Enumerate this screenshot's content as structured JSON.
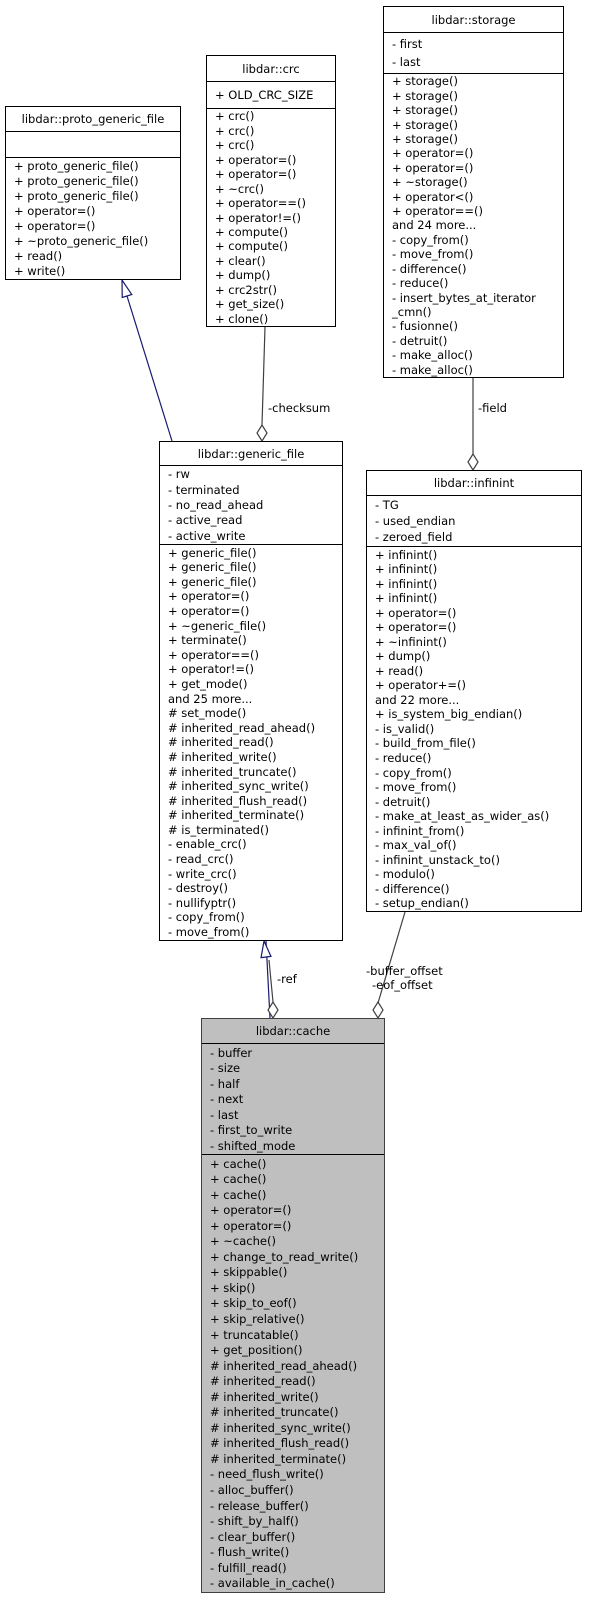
{
  "diagram": {
    "focus_class": "libdar::cache",
    "colors": {
      "inheritance": "#191970",
      "aggregation": "#404040",
      "focus_fill": "#bfbfbf"
    },
    "classes": [
      {
        "id": "proto",
        "name": "libdar::proto_generic_file",
        "attributes": [],
        "methods": [
          "+ proto_generic_file()",
          "+ proto_generic_file()",
          "+ proto_generic_file()",
          "+ operator=()",
          "+ operator=()",
          "+ ~proto_generic_file()",
          "+ read()",
          "+ write()"
        ]
      },
      {
        "id": "crc",
        "name": "libdar::crc",
        "attributes": [
          "+ OLD_CRC_SIZE"
        ],
        "methods": [
          "+ crc()",
          "+ crc()",
          "+ crc()",
          "+ operator=()",
          "+ operator=()",
          "+ ~crc()",
          "+ operator==()",
          "+ operator!=()",
          "+ compute()",
          "+ compute()",
          "+ clear()",
          "+ dump()",
          "+ crc2str()",
          "+ get_size()",
          "+ clone()"
        ]
      },
      {
        "id": "storage",
        "name": "libdar::storage",
        "attributes": [
          "- first",
          "- last"
        ],
        "methods": [
          "+ storage()",
          "+ storage()",
          "+ storage()",
          "+ storage()",
          "+ storage()",
          "+ operator=()",
          "+ operator=()",
          "+ ~storage()",
          "+ operator<()",
          "+ operator==()",
          "and 24 more...",
          "- copy_from()",
          "- move_from()",
          "- difference()",
          "- reduce()",
          "- insert_bytes_at_iterator",
          "_cmn()",
          "- fusionne()",
          "- detruit()",
          "- make_alloc()",
          "- make_alloc()"
        ]
      },
      {
        "id": "generic_file",
        "name": "libdar::generic_file",
        "attributes": [
          "- rw",
          "- terminated",
          "- no_read_ahead",
          "- active_read",
          "- active_write"
        ],
        "methods": [
          "+ generic_file()",
          "+ generic_file()",
          "+ generic_file()",
          "+ operator=()",
          "+ operator=()",
          "+ ~generic_file()",
          "+ terminate()",
          "+ operator==()",
          "+ operator!=()",
          "+ get_mode()",
          "and 25 more...",
          "# set_mode()",
          "# inherited_read_ahead()",
          "# inherited_read()",
          "# inherited_write()",
          "# inherited_truncate()",
          "# inherited_sync_write()",
          "# inherited_flush_read()",
          "# inherited_terminate()",
          "# is_terminated()",
          "- enable_crc()",
          "- read_crc()",
          "- write_crc()",
          "- destroy()",
          "- nullifyptr()",
          "- copy_from()",
          "- move_from()"
        ]
      },
      {
        "id": "infinint",
        "name": "libdar::infinint",
        "attributes": [
          "- TG",
          "- used_endian",
          "- zeroed_field"
        ],
        "methods": [
          "+ infinint()",
          "+ infinint()",
          "+ infinint()",
          "+ infinint()",
          "+ operator=()",
          "+ operator=()",
          "+ ~infinint()",
          "+ dump()",
          "+ read()",
          "+ operator+=()",
          "and 22 more...",
          "+ is_system_big_endian()",
          "- is_valid()",
          "- build_from_file()",
          "- reduce()",
          "- copy_from()",
          "- move_from()",
          "- detruit()",
          "- make_at_least_as_wider_as()",
          "- infinint_from()",
          "- max_val_of()",
          "- infinint_unstack_to()",
          "- modulo()",
          "- difference()",
          "- setup_endian()"
        ]
      },
      {
        "id": "cache",
        "name": "libdar::cache",
        "attributes": [
          "- buffer",
          "- size",
          "- half",
          "- next",
          "- last",
          "- first_to_write",
          "- shifted_mode"
        ],
        "methods": [
          "+ cache()",
          "+ cache()",
          "+ cache()",
          "+ operator=()",
          "+ operator=()",
          "+ ~cache()",
          "+ change_to_read_write()",
          "+ skippable()",
          "+ skip()",
          "+ skip_to_eof()",
          "+ skip_relative()",
          "+ truncatable()",
          "+ get_position()",
          "# inherited_read_ahead()",
          "# inherited_read()",
          "# inherited_write()",
          "# inherited_truncate()",
          "# inherited_sync_write()",
          "# inherited_flush_read()",
          "# inherited_terminate()",
          "- need_flush_write()",
          "- alloc_buffer()",
          "- release_buffer()",
          "- shift_by_half()",
          "- clear_buffer()",
          "- flush_write()",
          "- fulfill_read()",
          "- available_in_cache()"
        ]
      }
    ],
    "edges": [
      {
        "type": "inheritance",
        "from": "generic_file",
        "to": "proto",
        "label": ""
      },
      {
        "type": "aggregation",
        "from": "crc",
        "to": "generic_file",
        "label": "-checksum"
      },
      {
        "type": "aggregation",
        "from": "storage",
        "to": "infinint",
        "label": "-field"
      },
      {
        "type": "inheritance",
        "from": "cache",
        "to": "generic_file",
        "label": ""
      },
      {
        "type": "aggregation",
        "from": "generic_file",
        "to": "cache",
        "label": "-ref"
      },
      {
        "type": "aggregation",
        "from": "infinint",
        "to": "cache",
        "label": "-buffer_offset\n-eof_offset"
      }
    ]
  }
}
